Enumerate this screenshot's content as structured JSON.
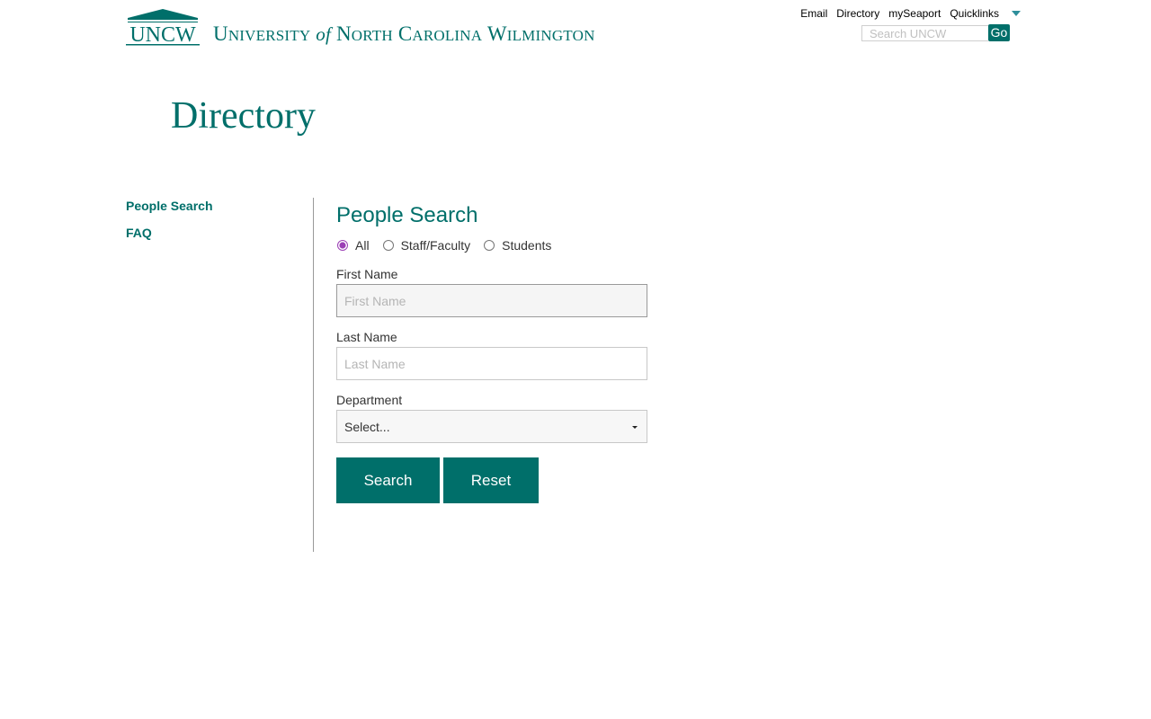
{
  "header": {
    "logo_text": "UNCW",
    "university_name": {
      "part1_initial": "U",
      "part1_rest": "NIVERSITY",
      "of": "of",
      "part2_initial": "N",
      "part2_rest": "ORTH",
      "part3_initial": "C",
      "part3_rest": "AROLINA",
      "part4_initial": "W",
      "part4_rest": "ILMINGTON"
    },
    "links": [
      "Email",
      "Directory",
      "mySeaport",
      "Quicklinks"
    ],
    "search": {
      "placeholder": "Search UNCW",
      "value": "",
      "go_label": "Go"
    }
  },
  "page_title": "Directory",
  "sidebar": {
    "items": [
      "People Search",
      "FAQ"
    ]
  },
  "form": {
    "title": "People Search",
    "radio_options": [
      {
        "label": "All",
        "checked": true
      },
      {
        "label": "Staff/Faculty",
        "checked": false
      },
      {
        "label": "Students",
        "checked": false
      }
    ],
    "first_name": {
      "label": "First Name",
      "placeholder": "First Name",
      "value": ""
    },
    "last_name": {
      "label": "Last Name",
      "placeholder": "Last Name",
      "value": ""
    },
    "department": {
      "label": "Department",
      "selected": "Select..."
    },
    "search_label": "Search",
    "reset_label": "Reset"
  },
  "colors": {
    "brand_teal": "#006f6a",
    "radio_accent": "#9b3fb5",
    "caret": "#2e8f9b"
  }
}
